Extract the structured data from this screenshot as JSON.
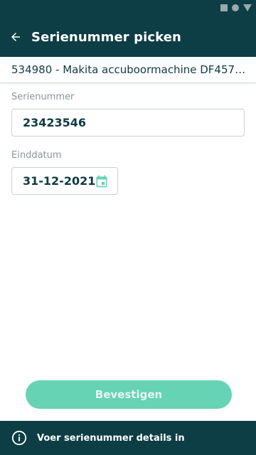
{
  "app_bar": {
    "title": "Serienummer picken"
  },
  "product": {
    "text": "534980 - Makita accuboormachine DF457D..."
  },
  "form": {
    "serial_label": "Serienummer",
    "serial_value": "23423546",
    "date_label": "Einddatum",
    "date_value": "31-12-2021"
  },
  "actions": {
    "confirm_label": "Bevestigen"
  },
  "snackbar": {
    "message": "Voer serienummer details in"
  },
  "colors": {
    "primary_dark": "#0d3d45",
    "accent": "#65d3b4",
    "text": "#0f3a44",
    "muted_label": "#8a9799"
  },
  "icons": {
    "back": "arrow-left-icon",
    "calendar": "calendar-icon",
    "info": "info-icon"
  }
}
